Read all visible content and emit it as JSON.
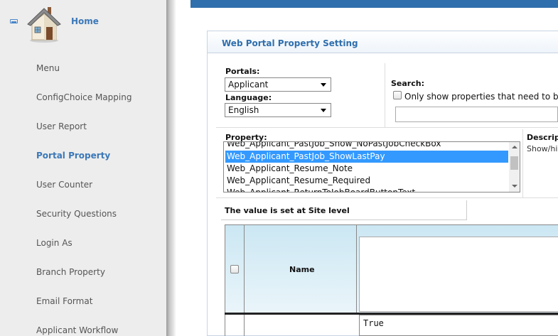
{
  "sidebar": {
    "home_label": "Home",
    "items": [
      {
        "label": "Menu"
      },
      {
        "label": "ConfigChoice Mapping"
      },
      {
        "label": "User Report"
      },
      {
        "label": "Portal Property",
        "active": true
      },
      {
        "label": "User Counter"
      },
      {
        "label": "Security Questions"
      },
      {
        "label": "Login As"
      },
      {
        "label": "Branch Property"
      },
      {
        "label": "Email Format"
      },
      {
        "label": "Applicant Workflow"
      }
    ]
  },
  "panel": {
    "title": "Web Portal Property Setting",
    "portals_label": "Portals:",
    "portals_value": "Applicant",
    "language_label": "Language:",
    "language_value": "English",
    "search_label": "Search:",
    "only_show_label": "Only show properties that need to be cha",
    "property_label": "Property:",
    "property_options": [
      "Web_Applicant_PastJob_Show_NoPastJobCheckBox",
      "Web_Applicant_PastJob_ShowLastPay",
      "Web_Applicant_Resume_Note",
      "Web_Applicant_Resume_Required",
      "Web_Applicant_ReturnToJobBoardButtonText"
    ],
    "selected_property_index": 1,
    "description_label": "Descript",
    "description_text": "Show/hi",
    "site_level_text": "The value is set at Site level"
  },
  "grid": {
    "name_header": "Name",
    "row_value": "True"
  },
  "colors": {
    "accent": "#3b78b8",
    "topbar": "#2f6fad",
    "selection": "#3399ff",
    "grid_header": "#cbe7f3"
  }
}
